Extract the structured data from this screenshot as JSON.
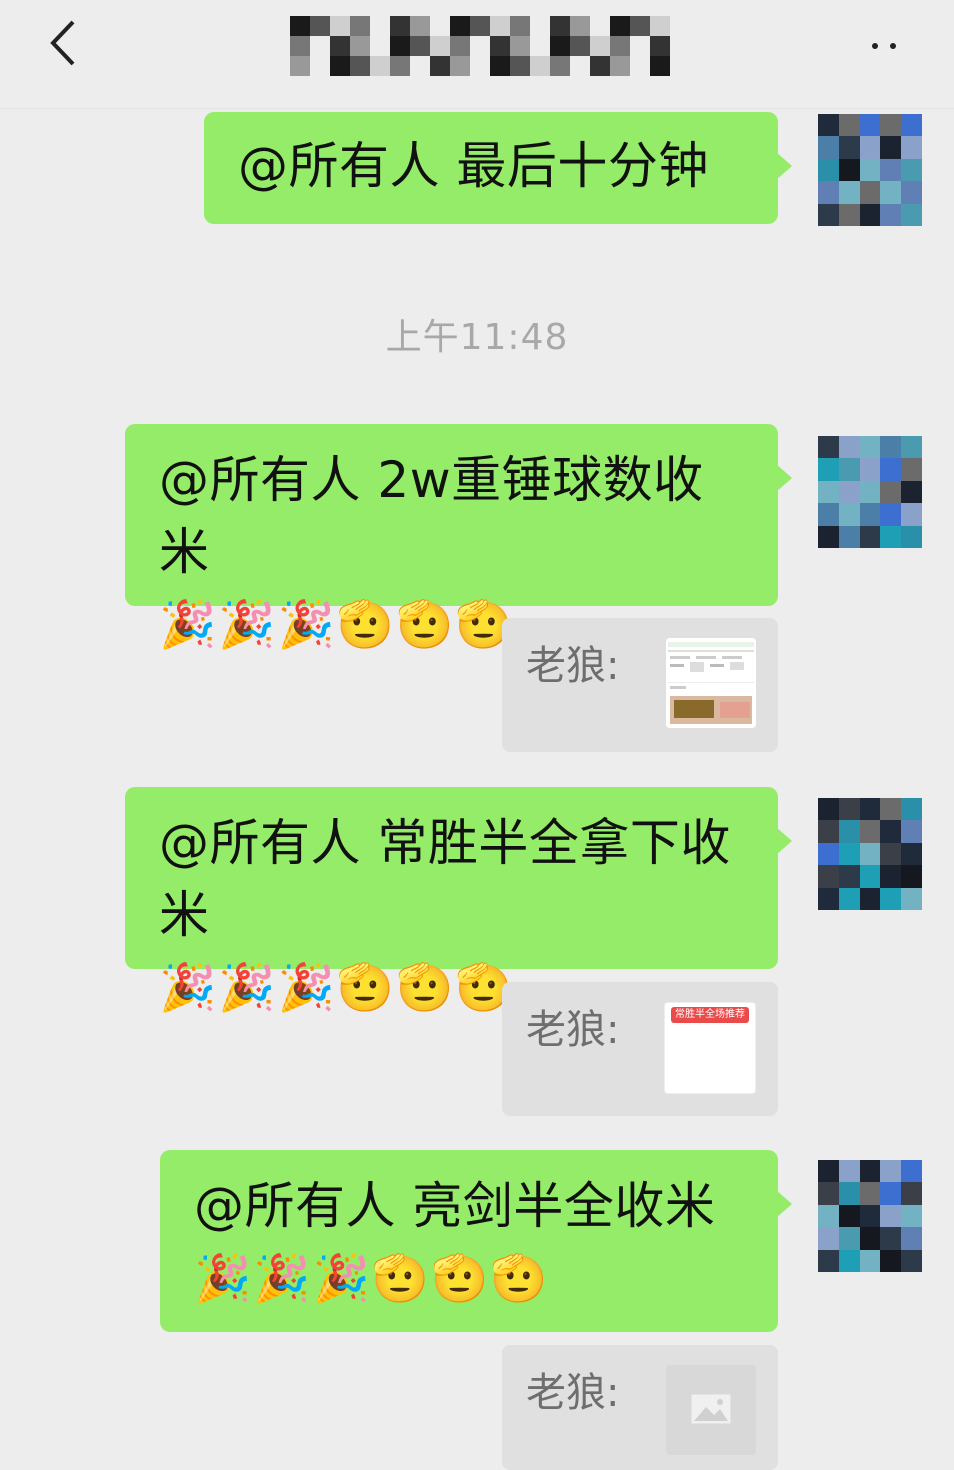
{
  "header": {
    "back_icon": "chevron-left-icon",
    "more_icon": "more-dots-icon"
  },
  "timestamp": "上午11:48",
  "messages": [
    {
      "text": "@所有人  最后十分钟",
      "emoji": ""
    },
    {
      "text": "@所有人 2w重锤球数收米",
      "emoji": "🎉🎉🎉🫡🫡🫡"
    },
    {
      "text": "@所有人 常胜半全拿下收米",
      "emoji": "🎉🎉🎉🫡🫡🫡"
    },
    {
      "text": "@所有人 亮剑半全收米",
      "emoji": "🎉🎉🎉🫡🫡🫡"
    }
  ],
  "quotes": [
    {
      "label": "老狼:",
      "thumb_icon": "document-screenshot-icon"
    },
    {
      "label": "老狼:",
      "thumb_badge": "常胜半全场推荐"
    },
    {
      "label": "老狼:",
      "thumb_icon": "image-placeholder-icon"
    }
  ],
  "colors": {
    "background": "#ededed",
    "bubble": "#95ec69",
    "quote": "#e0e0e0",
    "timestamp": "#a8a8a8",
    "badge": "#e94b4b"
  }
}
